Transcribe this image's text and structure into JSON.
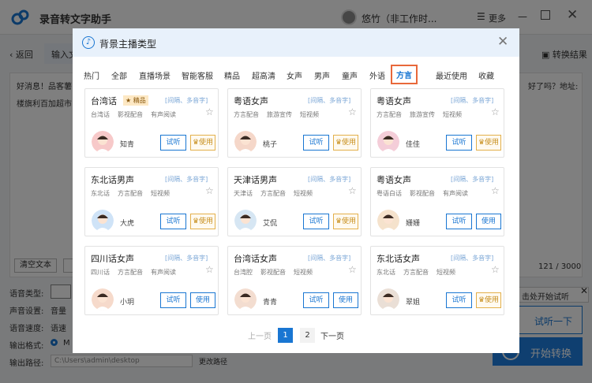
{
  "app": {
    "title": "录音转文字助手",
    "user": "悠竹（非工作时...",
    "more": "更多",
    "back": "返回",
    "tab_input": "输入文",
    "switch_result": "转换结果",
    "editor_line1": "好消息！品客薯",
    "editor_line2": "楼旗利百加超市",
    "editor_right": "好了吗？地址:",
    "clear_text": "清空文本",
    "char_count": "121 / 3000",
    "settings": {
      "voice_type_label": "语音类型:",
      "volume_label": "声音设置:",
      "volume_value": "音量",
      "speed_label": "语音速度:",
      "speed_value": "语速",
      "format_label": "输出格式:",
      "format_value": "M",
      "path_label": "输出路径:",
      "path_value": "C:\\Users\\admin\\desktop",
      "change_path": "更改路径"
    },
    "tip": "击处开始试听",
    "preview": "试听一下",
    "start": "开始转换"
  },
  "modal": {
    "title": "背景主播类型",
    "tabs": [
      "热门",
      "全部",
      "直播场景",
      "智能客服",
      "精品",
      "超高清",
      "女声",
      "男声",
      "童声",
      "外语",
      "方言",
      "最近使用",
      "收藏"
    ],
    "active_tab": "方言",
    "cards": [
      {
        "name": "台湾话",
        "badge": "★ 精品",
        "features": "[间隔、多音字]",
        "tags": [
          "台湾话",
          "影视配音",
          "有声阅读"
        ],
        "person": "知青",
        "listen": "试听",
        "use": "使用",
        "premium": true
      },
      {
        "name": "粤语女声",
        "badge": "",
        "features": "[间隔、多音字]",
        "tags": [
          "方言配音",
          "旅游宣传",
          "短视频"
        ],
        "person": "桃子",
        "listen": "试听",
        "use": "使用",
        "premium": true
      },
      {
        "name": "粤语女声",
        "badge": "",
        "features": "[间隔、多音字]",
        "tags": [
          "方言配音",
          "旅游宣传",
          "短视频"
        ],
        "person": "佳佳",
        "listen": "试听",
        "use": "使用",
        "premium": true
      },
      {
        "name": "东北话男声",
        "badge": "",
        "features": "[间隔、多音字]",
        "tags": [
          "东北话",
          "方言配音",
          "短视频"
        ],
        "person": "大虎",
        "listen": "试听",
        "use": "使用",
        "premium": true
      },
      {
        "name": "天津话男声",
        "badge": "",
        "features": "[间隔、多音字]",
        "tags": [
          "天津话",
          "方言配音",
          "短视频"
        ],
        "person": "艾侃",
        "listen": "试听",
        "use": "使用",
        "premium": true
      },
      {
        "name": "粤语女声",
        "badge": "",
        "features": "[间隔、多音字]",
        "tags": [
          "粤语白话",
          "影视配音",
          "有声阅读"
        ],
        "person": "姗姗",
        "listen": "试听",
        "use": "使用",
        "premium": false
      },
      {
        "name": "四川话女声",
        "badge": "",
        "features": "[间隔、多音字]",
        "tags": [
          "四川话",
          "方言配音",
          "有声阅读"
        ],
        "person": "小玥",
        "listen": "试听",
        "use": "使用",
        "premium": false
      },
      {
        "name": "台湾话女声",
        "badge": "",
        "features": "[间隔、多音字]",
        "tags": [
          "台湾腔",
          "影视配音",
          "短视频"
        ],
        "person": "青青",
        "listen": "试听",
        "use": "使用",
        "premium": false
      },
      {
        "name": "东北话女声",
        "badge": "",
        "features": "[间隔、多音字]",
        "tags": [
          "东北话",
          "方言配音",
          "短视频"
        ],
        "person": "翠姐",
        "listen": "试听",
        "use": "使用",
        "premium": true
      }
    ],
    "pager": {
      "prev": "上一页",
      "page1": "1",
      "page2": "2",
      "next": "下一页"
    }
  },
  "colors": {
    "accent": "#1976d2",
    "premium": "#e3b04b",
    "active_tab_border": "#e8683a"
  }
}
